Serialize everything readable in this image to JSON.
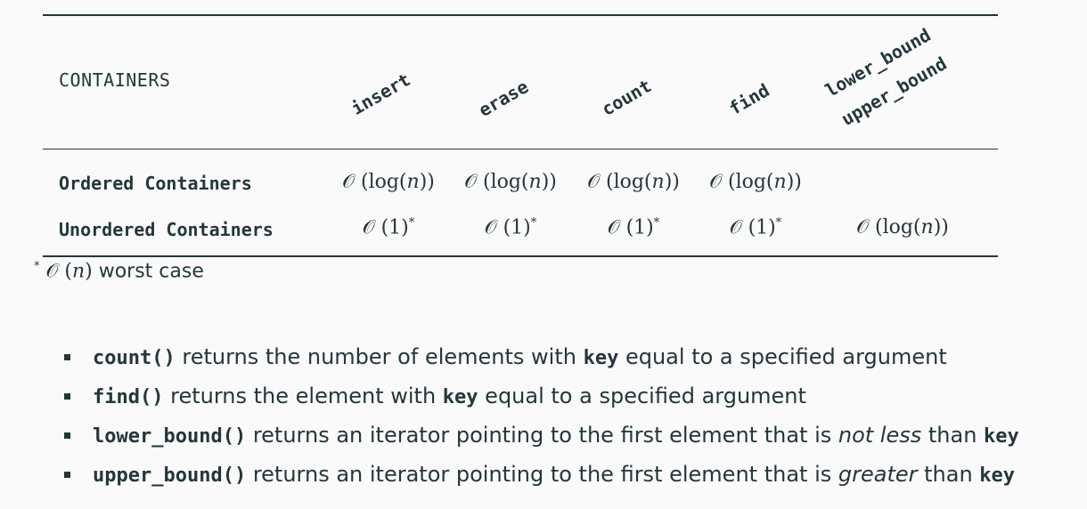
{
  "table": {
    "header_label": "CONTAINERS",
    "columns": [
      "insert",
      "erase",
      "count",
      "find",
      "lower_bound",
      "upper_bound"
    ],
    "rows": [
      {
        "label": "Ordered Containers",
        "cells": [
          "𝒪 (log(",
          "𝒪 (log(",
          "𝒪 (log(",
          "𝒪 (log("
        ]
      },
      {
        "label": "Unordered Containers",
        "cells": [
          "𝒪 (1)",
          "𝒪 (1)",
          "𝒪 (1)",
          "𝒪 (1)",
          "𝒪 (log("
        ]
      }
    ],
    "cell_var": "n",
    "cell_close": "))",
    "asterisk": "*"
  },
  "footnote": {
    "marker": "*",
    "big_o": "𝒪 (",
    "var": "n",
    "close": ")",
    "text": " worst case"
  },
  "bullets": [
    {
      "code": "count()",
      "text": " returns the number of elements with ",
      "code2": "key",
      "text2": " equal to a specified argument"
    },
    {
      "code": "find()",
      "text": " returns the element with ",
      "code2": "key",
      "text2": " equal to a specified argument"
    },
    {
      "code": "lower_bound()",
      "text": " returns an iterator pointing to the first element that is ",
      "em": "not less",
      "text2": " than ",
      "code2": "key"
    },
    {
      "code": "upper_bound()",
      "text": " returns an iterator pointing to the first element that is ",
      "em": "greater",
      "text2": " than ",
      "code2": "key"
    }
  ]
}
